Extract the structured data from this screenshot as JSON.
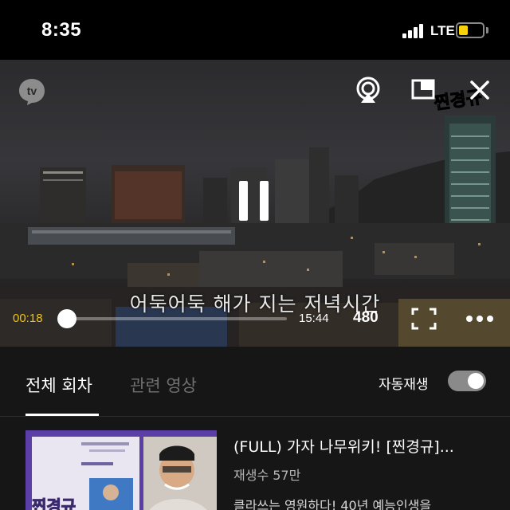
{
  "status_bar": {
    "time": "8:35",
    "network": "LTE",
    "battery_level": 0.4,
    "battery_color": "#f5d20a"
  },
  "player": {
    "logo_text": "tv",
    "watermark": "찐경규",
    "subtitle": "어둑어둑 해가 지는 저녁시간",
    "current_time": "00:18",
    "total_time": "15:44",
    "quality": "480",
    "progress": 0.02,
    "accent_color": "#f1c40f",
    "icons": [
      "airplay-icon",
      "pip-icon",
      "close-icon",
      "pause-icon",
      "fullscreen-icon",
      "more-icon"
    ]
  },
  "tabs": {
    "items": [
      {
        "label": "전체 회차",
        "active": true
      },
      {
        "label": "관련 영상",
        "active": false
      }
    ],
    "autoplay_label": "자동재생",
    "autoplay_on": true
  },
  "episodes": [
    {
      "title": "(FULL) 가자 나무위키! [찐경규]...",
      "views": "재생수 57만",
      "description": "클라쓰는 영원하다! 40년 예능인생을",
      "thumb_logo": "찐경규"
    }
  ]
}
